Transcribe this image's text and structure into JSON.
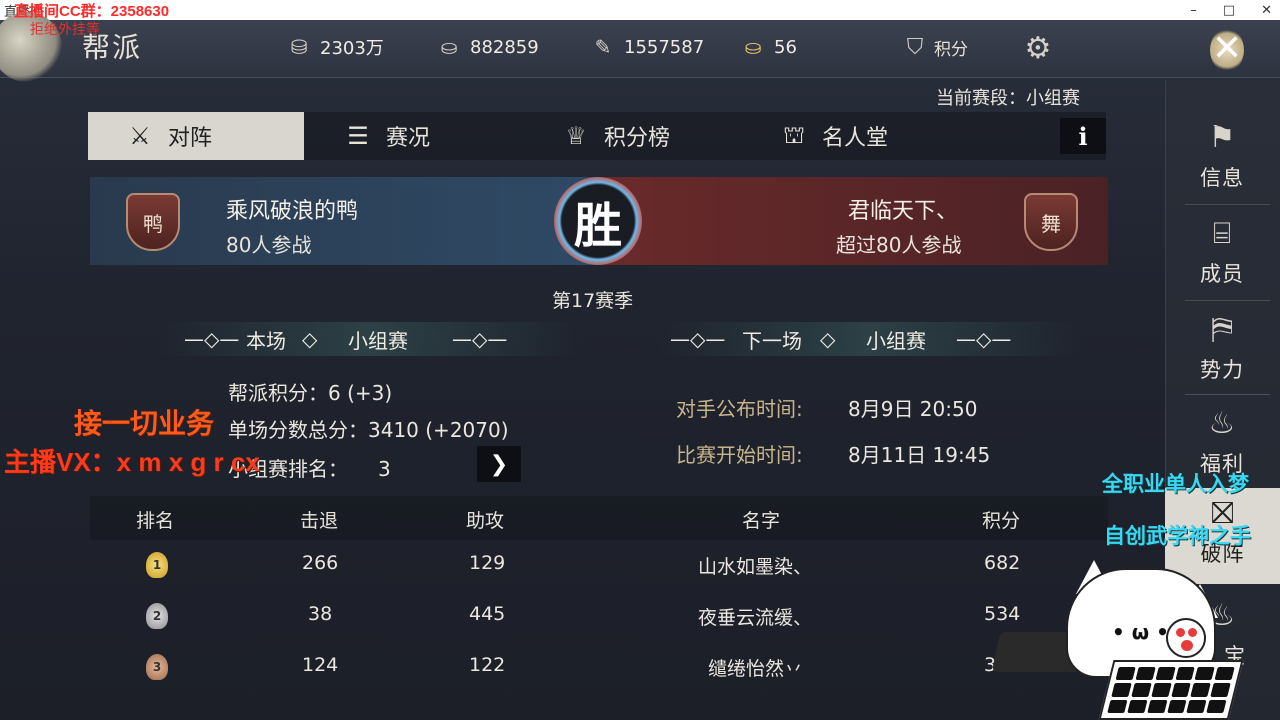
{
  "window": {
    "title": "直播间",
    "controls": [
      "–",
      "□",
      "✕"
    ]
  },
  "stream_overlay": {
    "qq_group": "直播间CC群：2358630",
    "refuse_text": "拒绝外挂等",
    "business": "接一切业务",
    "wechat": "主播VX：x m x g r cx",
    "right_line1": "全职业单人入梦",
    "right_line2": "自创武学神之手"
  },
  "header": {
    "title": "帮派",
    "currencies": [
      {
        "icon": "coin-icon",
        "value": "2303万"
      },
      {
        "icon": "silver-ingot-icon",
        "value": "882859"
      },
      {
        "icon": "feather-icon",
        "value": "1557587"
      },
      {
        "icon": "gold-ingot-icon",
        "value": "56"
      }
    ],
    "points_label": "积分"
  },
  "stage": "当前赛段：小组赛",
  "tabs": [
    {
      "label": "对阵",
      "icon": "crossed-swords-icon"
    },
    {
      "label": "赛况",
      "icon": "document-icon"
    },
    {
      "label": "积分榜",
      "icon": "trophy-icon"
    },
    {
      "label": "名人堂",
      "icon": "hall-icon"
    }
  ],
  "info_label": "i",
  "versus": {
    "left": {
      "badge": "鸭",
      "name": "乘风破浪的鸭",
      "participants": "80人参战"
    },
    "right": {
      "badge": "舞",
      "name": "君临天下、",
      "participants": "超过80人参战"
    },
    "result": "胜"
  },
  "season": "第17赛季",
  "current_match": {
    "label": "本场",
    "stage": "小组赛"
  },
  "next_match": {
    "label": "下一场",
    "stage": "小组赛"
  },
  "stats": {
    "guild_points_label": "帮派积分：",
    "guild_points_value": "6 (+3)",
    "total_score_label": "单场分数总分：",
    "total_score_value": "3410 (+2070)",
    "group_rank_label": "小组赛排名：",
    "group_rank_value": "3",
    "opponent_time_label": "对手公布时间:",
    "opponent_time_value": "8月9日 20:50",
    "match_time_label": "比赛开始时间:",
    "match_time_value": "8月11日 19:45"
  },
  "table": {
    "headers": [
      "排名",
      "击退",
      "助攻",
      "名字",
      "积分"
    ],
    "rows": [
      {
        "rank": "1",
        "kills": "266",
        "assists": "129",
        "name": "山水如墨染、",
        "points": "682"
      },
      {
        "rank": "2",
        "kills": "38",
        "assists": "445",
        "name": "夜垂云流缓、",
        "points": "534"
      },
      {
        "rank": "3",
        "kills": "124",
        "assists": "122",
        "name": "缱绻怡然丷",
        "points": "386"
      }
    ]
  },
  "sidebar": [
    {
      "label": "信息",
      "icon": "flag-icon"
    },
    {
      "label": "成员",
      "icon": "scroll-icon"
    },
    {
      "label": "势力",
      "icon": "banner-icon"
    },
    {
      "label": "福利",
      "icon": "money-bag-icon"
    },
    {
      "label": "破阵",
      "icon": "formation-icon",
      "active": true
    },
    {
      "label": "宝",
      "icon": "treasure-icon"
    }
  ],
  "colors": {
    "left_team": "#2f4a66",
    "right_team": "#6a2a2a",
    "overlay_orange": "#ff5a1a",
    "overlay_cyan": "#3ad8f0"
  }
}
